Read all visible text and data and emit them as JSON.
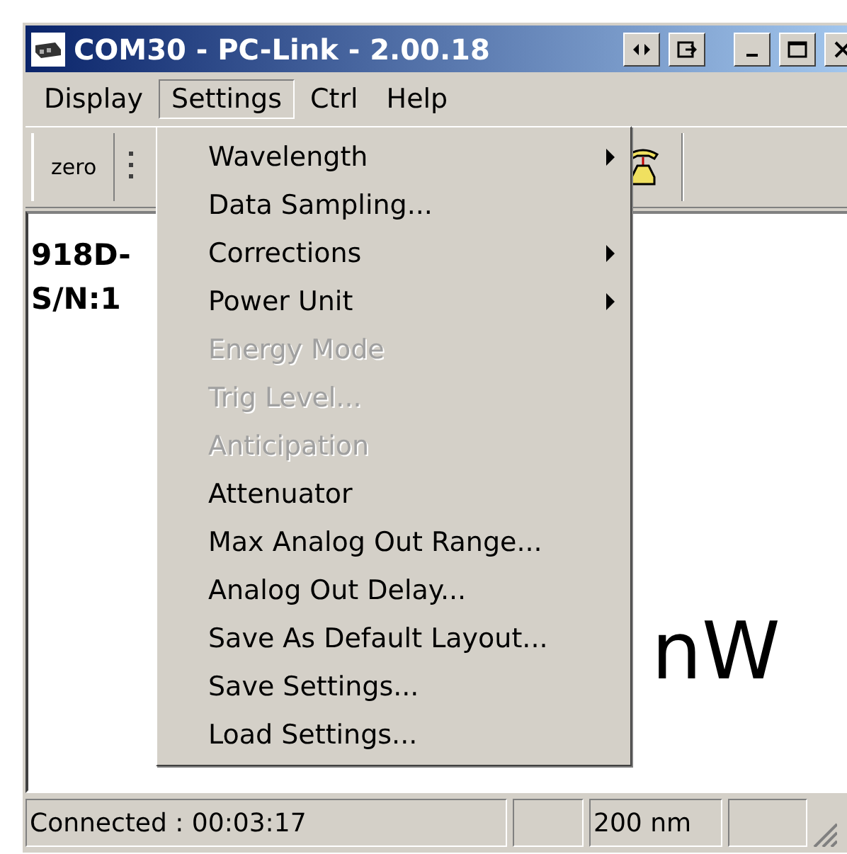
{
  "window": {
    "title": "COM30 - PC-Link - 2.00.18"
  },
  "menu_bar": [
    {
      "label": "Display",
      "selected": false
    },
    {
      "label": "Settings",
      "selected": true
    },
    {
      "label": "Ctrl",
      "selected": false
    },
    {
      "label": "Help",
      "selected": false
    }
  ],
  "toolbar": {
    "buttons": [
      {
        "label": "zero"
      }
    ]
  },
  "content": {
    "model": "918D-",
    "serial": "S/N:1",
    "unit": "nW"
  },
  "settings_menu": [
    {
      "label": "Wavelength",
      "disabled": false,
      "submenu": true
    },
    {
      "label": "Data Sampling...",
      "disabled": false,
      "submenu": false
    },
    {
      "label": "Corrections",
      "disabled": false,
      "submenu": true
    },
    {
      "label": "Power Unit",
      "disabled": false,
      "submenu": true
    },
    {
      "label": "Energy Mode",
      "disabled": true,
      "submenu": false
    },
    {
      "label": "Trig Level...",
      "disabled": true,
      "submenu": false
    },
    {
      "label": "Anticipation",
      "disabled": true,
      "submenu": false
    },
    {
      "label": "Attenuator",
      "disabled": false,
      "submenu": false
    },
    {
      "label": "Max Analog Out Range...",
      "disabled": false,
      "submenu": false
    },
    {
      "label": "Analog Out Delay...",
      "disabled": false,
      "submenu": false
    },
    {
      "label": "Save As Default Layout...",
      "disabled": false,
      "submenu": false
    },
    {
      "label": "Save Settings...",
      "disabled": false,
      "submenu": false
    },
    {
      "label": "Load Settings...",
      "disabled": false,
      "submenu": false
    }
  ],
  "status_bar": {
    "connection": "Connected : 00:03:17",
    "wavelength": "200 nm"
  }
}
